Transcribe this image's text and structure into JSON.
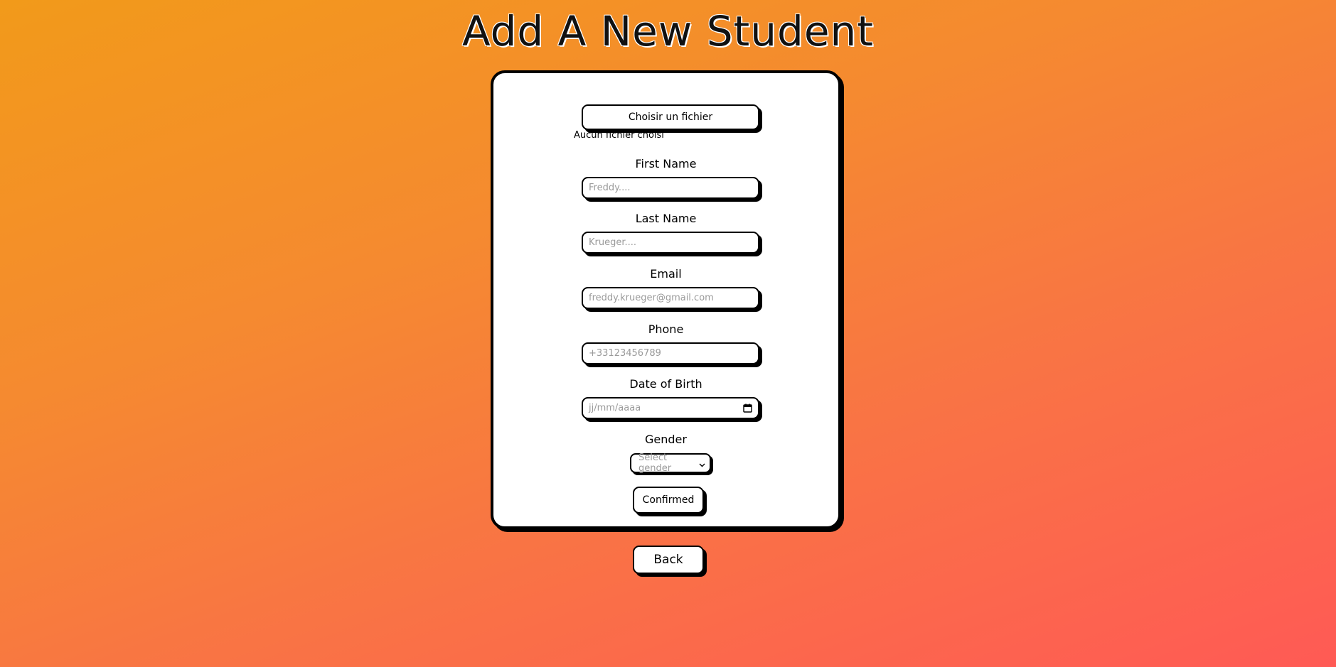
{
  "page": {
    "title": "Add A New Student"
  },
  "form": {
    "file_button_label": "Choisir un fichier",
    "file_status": "Aucun fichier choisi",
    "first_name": {
      "label": "First Name",
      "placeholder": "Freddy...."
    },
    "last_name": {
      "label": "Last Name",
      "placeholder": "Krueger...."
    },
    "email": {
      "label": "Email",
      "placeholder": "freddy.krueger@gmail.com"
    },
    "phone": {
      "label": "Phone",
      "placeholder": "+33123456789"
    },
    "dob": {
      "label": "Date of Birth",
      "placeholder": "jj/mm/aaaa",
      "icon": "calendar-icon"
    },
    "gender": {
      "label": "Gender",
      "selected": "Select gender",
      "icon": "chevron-down-icon"
    },
    "confirm_label": "Confirmed"
  },
  "nav": {
    "back_label": "Back"
  }
}
